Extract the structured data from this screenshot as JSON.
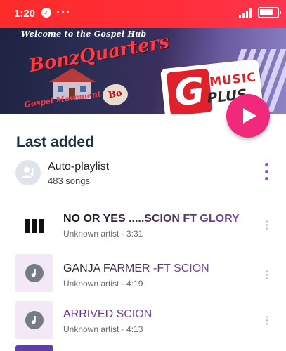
{
  "status_bar": {
    "time": "1:20",
    "more": "···",
    "battery_level_fraction": 0.8
  },
  "banner": {
    "welcome": "Welcome to the Gospel Hub",
    "brand": "BonzQuarters",
    "subtitle": "Gospel Movement",
    "badge": "Bo",
    "logo_line1": "MUSIC",
    "logo_line2": "PLUS"
  },
  "section": {
    "title": "Last added"
  },
  "playlist": {
    "title": "Auto-playlist",
    "count": "483 songs"
  },
  "songs": [
    {
      "title": "NO OR YES .....SCION FT GLORY",
      "subtitle": "Unknown artist · 3:31",
      "thumb": "bars-artwork",
      "title_color_start": "#111111",
      "title_color_end": "#7a4aa0"
    },
    {
      "title": "GANJA FARMER -FT SCION",
      "subtitle": "Unknown artist · 4:19",
      "thumb": "music-note-icon",
      "title_color_start": "#222222",
      "title_color_end": "#7a4aa0"
    },
    {
      "title": "ARRIVED SCION",
      "subtitle": "Unknown artist · 4:13",
      "thumb": "music-note-icon",
      "title_color_start": "#5a2a8a",
      "title_color_end": "#7a4aa0"
    }
  ],
  "colors": {
    "status_bar": "#ff2b2b",
    "accent": "#f0297b",
    "more_dots": "#9b4fb0"
  }
}
